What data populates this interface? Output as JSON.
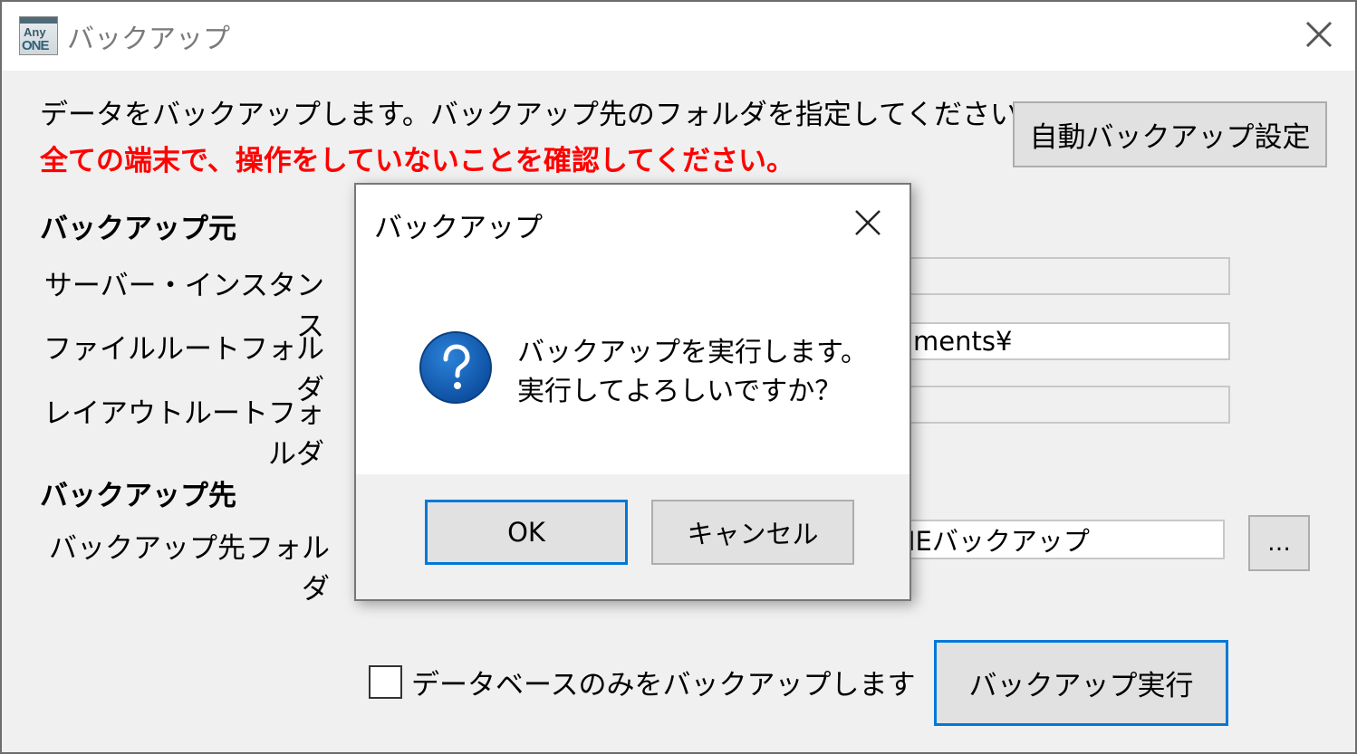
{
  "window": {
    "title": "バックアップ",
    "logo": {
      "line1": "Any",
      "line2": "ONE"
    }
  },
  "instructions": {
    "line1": "データをバックアップします。バックアップ先のフォルダを指定してください。",
    "warning": "全ての端末で、操作をしていないことを確認してください。"
  },
  "auto_backup_button": "自動バックアップ設定",
  "source": {
    "heading": "バックアップ元",
    "server_label": "サーバー・インスタンス",
    "server_value": "",
    "file_root_label": "ファイルルートフォルダ",
    "file_root_value": "ments¥",
    "layout_root_label": "レイアウトルートフォルダ",
    "layout_root_value": ""
  },
  "destination": {
    "heading": "バックアップ先",
    "folder_label": "バックアップ先フォルダ",
    "folder_value": "IEバックアップ",
    "browse_button": "…"
  },
  "db_only_checkbox": {
    "label": "データベースのみをバックアップします",
    "checked": false
  },
  "execute_button": "バックアップ実行",
  "dialog": {
    "title": "バックアップ",
    "message_line1": "バックアップを実行します。",
    "message_line2": "実行してよろしいですか？",
    "ok_button": "OK",
    "cancel_button": "キャンセル",
    "icon": "question-icon"
  },
  "colors": {
    "warning": "#ff0000",
    "focus_border": "#0078d7",
    "question_icon": "#1565c0"
  }
}
